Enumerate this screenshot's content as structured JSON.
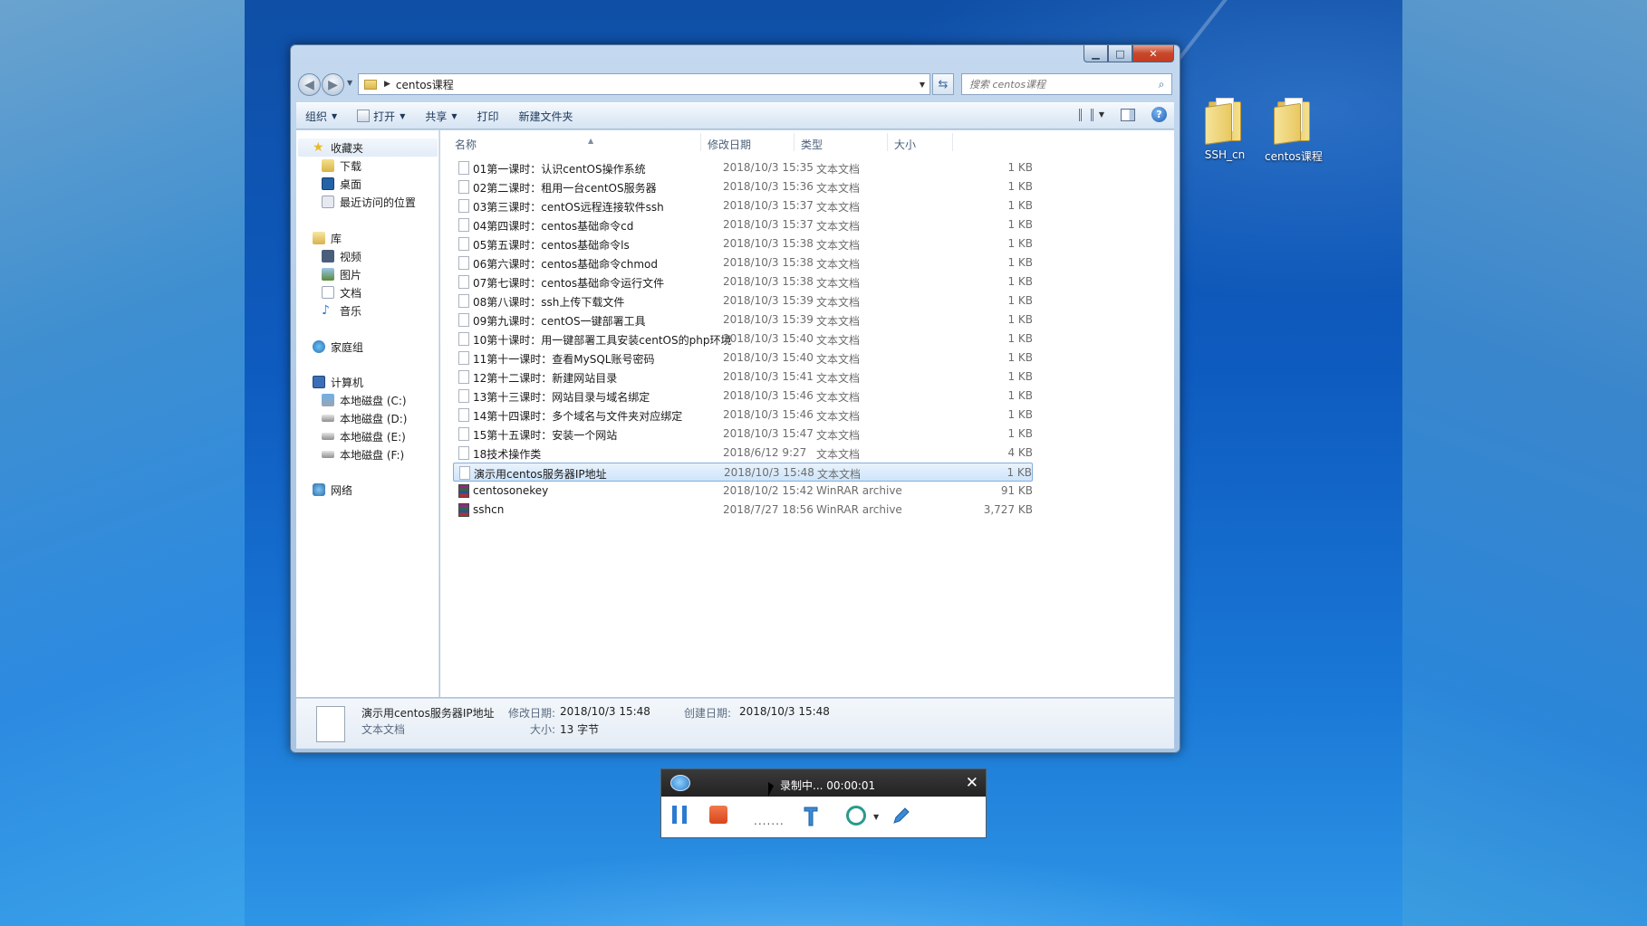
{
  "desktop": {
    "icons": [
      {
        "label": "SSH_cn"
      },
      {
        "label": "centos课程"
      }
    ]
  },
  "explorer": {
    "address": {
      "path": "centos课程"
    },
    "search": {
      "placeholder": "搜索 centos课程"
    },
    "toolbar": {
      "organize": "组织",
      "open": "打开",
      "share": "共享",
      "print": "打印",
      "new_folder": "新建文件夹"
    },
    "nav": {
      "favorites": "收藏夹",
      "downloads": "下载",
      "desktop": "桌面",
      "recent": "最近访问的位置",
      "libraries": "库",
      "videos": "视频",
      "pictures": "图片",
      "documents": "文档",
      "music": "音乐",
      "homegroup": "家庭组",
      "computer": "计算机",
      "drive_c": "本地磁盘 (C:)",
      "drive_d": "本地磁盘 (D:)",
      "drive_e": "本地磁盘 (E:)",
      "drive_f": "本地磁盘 (F:)",
      "network": "网络"
    },
    "columns": {
      "name": "名称",
      "modified": "修改日期",
      "type": "类型",
      "size": "大小"
    },
    "files": [
      {
        "name": "01第一课时：认识centOS操作系统",
        "date": "2018/10/3 15:35",
        "type": "文本文档",
        "size": "1 KB",
        "icon": "text-file"
      },
      {
        "name": "02第二课时：租用一台centOS服务器",
        "date": "2018/10/3 15:36",
        "type": "文本文档",
        "size": "1 KB",
        "icon": "text-file"
      },
      {
        "name": "03第三课时：centOS远程连接软件ssh",
        "date": "2018/10/3 15:37",
        "type": "文本文档",
        "size": "1 KB",
        "icon": "text-file"
      },
      {
        "name": "04第四课时：centos基础命令cd",
        "date": "2018/10/3 15:37",
        "type": "文本文档",
        "size": "1 KB",
        "icon": "text-file"
      },
      {
        "name": "05第五课时：centos基础命令ls",
        "date": "2018/10/3 15:38",
        "type": "文本文档",
        "size": "1 KB",
        "icon": "text-file"
      },
      {
        "name": "06第六课时：centos基础命令chmod",
        "date": "2018/10/3 15:38",
        "type": "文本文档",
        "size": "1 KB",
        "icon": "text-file"
      },
      {
        "name": "07第七课时：centos基础命令运行文件",
        "date": "2018/10/3 15:38",
        "type": "文本文档",
        "size": "1 KB",
        "icon": "text-file"
      },
      {
        "name": "08第八课时：ssh上传下载文件",
        "date": "2018/10/3 15:39",
        "type": "文本文档",
        "size": "1 KB",
        "icon": "text-file"
      },
      {
        "name": "09第九课时：centOS一键部署工具",
        "date": "2018/10/3 15:39",
        "type": "文本文档",
        "size": "1 KB",
        "icon": "text-file"
      },
      {
        "name": "10第十课时：用一键部署工具安装centOS的php环境",
        "date": "2018/10/3 15:40",
        "type": "文本文档",
        "size": "1 KB",
        "icon": "text-file"
      },
      {
        "name": "11第十一课时：查看MySQL账号密码",
        "date": "2018/10/3 15:40",
        "type": "文本文档",
        "size": "1 KB",
        "icon": "text-file"
      },
      {
        "name": "12第十二课时：新建网站目录",
        "date": "2018/10/3 15:41",
        "type": "文本文档",
        "size": "1 KB",
        "icon": "text-file"
      },
      {
        "name": "13第十三课时：网站目录与域名绑定",
        "date": "2018/10/3 15:46",
        "type": "文本文档",
        "size": "1 KB",
        "icon": "text-file"
      },
      {
        "name": "14第十四课时：多个域名与文件夹对应绑定",
        "date": "2018/10/3 15:46",
        "type": "文本文档",
        "size": "1 KB",
        "icon": "text-file"
      },
      {
        "name": "15第十五课时：安装一个网站",
        "date": "2018/10/3 15:47",
        "type": "文本文档",
        "size": "1 KB",
        "icon": "text-file"
      },
      {
        "name": "18技术操作类",
        "date": "2018/6/12 9:27",
        "type": "文本文档",
        "size": "4 KB",
        "icon": "text-file"
      },
      {
        "name": "演示用centos服务器IP地址",
        "date": "2018/10/3 15:48",
        "type": "文本文档",
        "size": "1 KB",
        "icon": "text-file",
        "selected": true
      },
      {
        "name": "centosonekey",
        "date": "2018/10/2 15:42",
        "type": "WinRAR archive",
        "size": "91 KB",
        "icon": "rar-archive"
      },
      {
        "name": "sshcn",
        "date": "2018/7/27 18:56",
        "type": "WinRAR archive",
        "size": "3,727 KB",
        "icon": "rar-archive"
      }
    ],
    "details": {
      "name": "演示用centos服务器IP地址",
      "type": "文本文档",
      "modified_label": "修改日期:",
      "modified": "2018/10/3 15:48",
      "created_label": "创建日期:",
      "created": "2018/10/3 15:48",
      "size_label": "大小:",
      "size": "13 字节"
    }
  },
  "recorder": {
    "status": "录制中... 00:00:01",
    "dots": "......."
  }
}
